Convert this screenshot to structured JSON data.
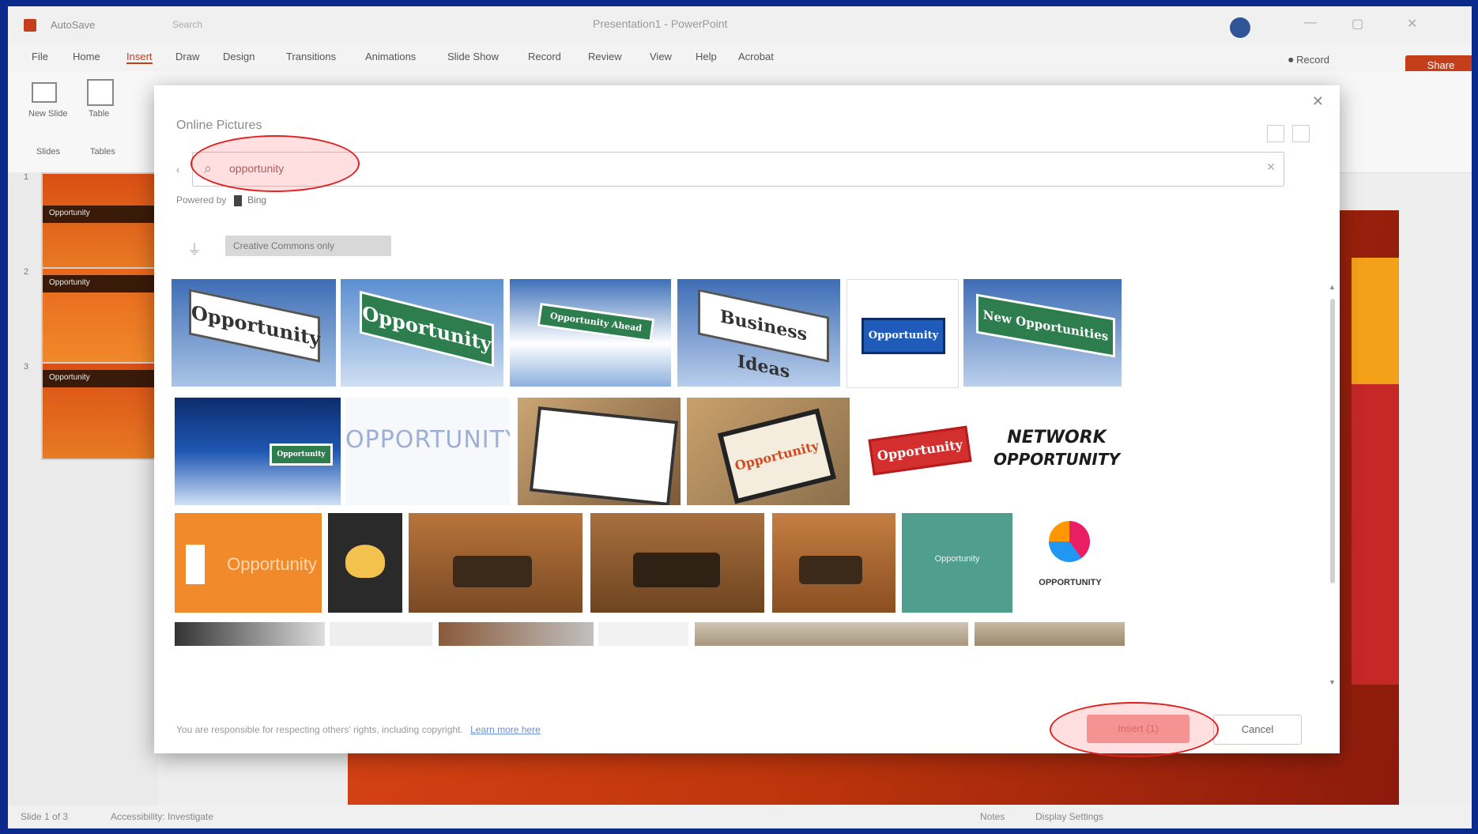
{
  "titlebar": {
    "autosave": "AutoSave",
    "search_placeholder": "Search",
    "filename": "Presentation1 - PowerPoint",
    "controls": [
      "—",
      "▢",
      "✕"
    ]
  },
  "menu": {
    "items": [
      "File",
      "Home",
      "Insert",
      "Draw",
      "Design",
      "Transitions",
      "Animations",
      "Slide Show",
      "Record",
      "Review",
      "View",
      "Help",
      "Acrobat"
    ],
    "active": "Insert",
    "record": "⏺ Record",
    "share": "Share"
  },
  "ribbon": {
    "new_slide": "New Slide",
    "table": "Table",
    "slides_group": "Slides",
    "tables_group": "Tables"
  },
  "thumbnails": [
    {
      "num": "1",
      "label": "Opportunity"
    },
    {
      "num": "2",
      "label": "Opportunity"
    },
    {
      "num": "3",
      "label": "Opportunity"
    }
  ],
  "dialog": {
    "title": "Online Pictures",
    "search_value": "opportunity",
    "powered_by": "Powered by",
    "powered_brand": "Bing",
    "filter_chip": "Creative Commons only",
    "images": [
      {
        "caption": "Opportunity"
      },
      {
        "caption": "Opportunity"
      },
      {
        "caption": "Opportunity Ahead"
      },
      {
        "caption": "Business Ideas"
      },
      {
        "caption": "Opportunity"
      },
      {
        "caption": "New Opportunities"
      },
      {
        "caption": "Opportunity"
      },
      {
        "caption": "OPPORTUNITY"
      },
      {
        "caption": ""
      },
      {
        "caption": "Opportunity"
      },
      {
        "caption": "Opportunity"
      },
      {
        "caption": "NETWORK"
      },
      {
        "caption": "OPPORTUNITY"
      },
      {
        "caption": "Opportunity"
      },
      {
        "caption": ""
      },
      {
        "caption": ""
      },
      {
        "caption": ""
      },
      {
        "caption": ""
      },
      {
        "caption": "Opportunity"
      },
      {
        "caption": "OPPORTUNITY"
      }
    ],
    "footer_text": "You are responsible for respecting others' rights, including copyright.",
    "footer_link": "Learn more here",
    "insert_label": "Insert (1)",
    "cancel_label": "Cancel"
  },
  "status": {
    "slide_info": "Slide 1 of 3",
    "accessibility": "Accessibility: Investigate",
    "notes": "Notes",
    "display": "Display Settings"
  },
  "colors": {
    "accent": "#c43e1c",
    "highlight": "#e02020",
    "background": "#0a2a8c"
  }
}
